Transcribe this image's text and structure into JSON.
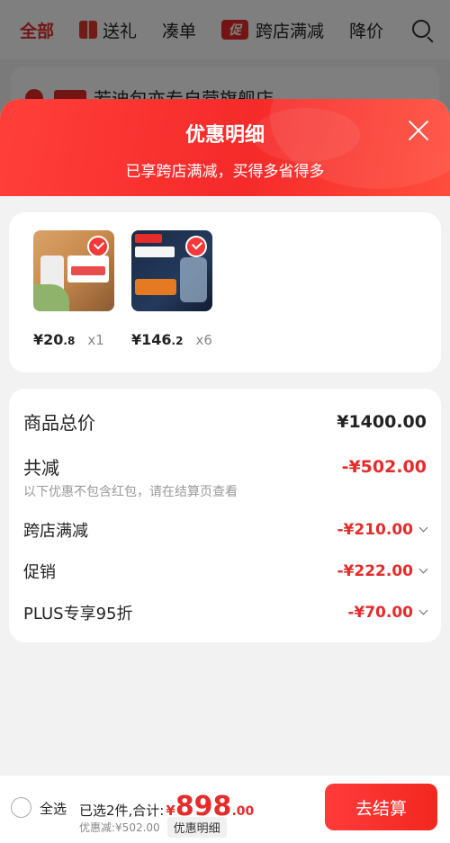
{
  "background": {
    "tabs": [
      "全部",
      "送礼",
      "凑单",
      "跨店满减",
      "降价"
    ],
    "store_name": "若迪包亦专自营旗舰店"
  },
  "sheet": {
    "title": "优惠明细",
    "subtitle": "已享跨店满减，买得多省得多"
  },
  "products": [
    {
      "price_symbol": "¥",
      "price_int": "20",
      "price_dec": ".8",
      "qty": "x1"
    },
    {
      "price_symbol": "¥",
      "price_int": "146",
      "price_dec": ".2",
      "qty": "x6"
    }
  ],
  "summary": {
    "total_label": "商品总价",
    "total_value": "¥1400.00",
    "reduce_label": "共减",
    "reduce_value": "-¥502.00",
    "note": "以下优惠不包含红包，请在结算页查看",
    "items": [
      {
        "label": "跨店满减",
        "value": "-¥210.00"
      },
      {
        "label": "促销",
        "value": "-¥222.00"
      },
      {
        "label": "PLUS专享95折",
        "value": "-¥70.00"
      }
    ]
  },
  "bottom": {
    "select_all": "全选",
    "selected_text": "已选2件,合计:",
    "total_symbol": "¥",
    "total_int": "898",
    "total_dec": ".00",
    "discount_text": "优惠减:¥502.00",
    "detail_button": "优惠明细",
    "checkout_button": "去结算"
  },
  "colors": {
    "accent": "#e62b2b",
    "header_gradient": "#f52a2a"
  }
}
